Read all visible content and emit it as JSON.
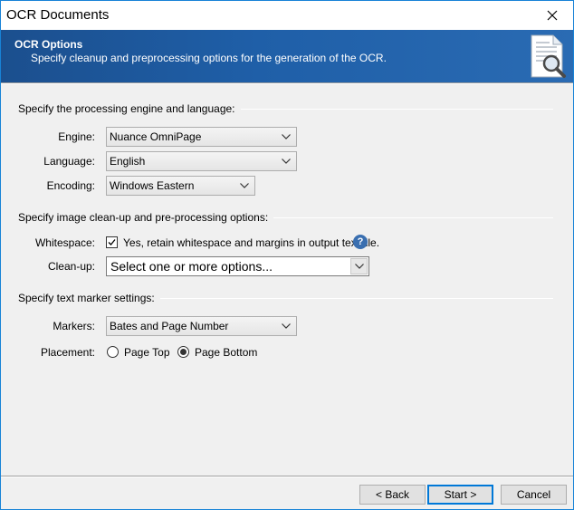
{
  "window": {
    "title": "OCR Documents"
  },
  "banner": {
    "title": "OCR Options",
    "subtitle": "Specify cleanup and preprocessing options for the generation of the OCR.",
    "icon": "document-search-icon"
  },
  "engine_group": {
    "header": "Specify the processing engine and language:",
    "engine_label": "Engine:",
    "engine_value": "Nuance OmniPage",
    "language_label": "Language:",
    "language_value": "English",
    "encoding_label": "Encoding:",
    "encoding_value": "Windows Eastern"
  },
  "cleanup_group": {
    "header": "Specify image clean-up and pre-processing options:",
    "whitespace_label": "Whitespace:",
    "whitespace_checked": true,
    "whitespace_text": "Yes, retain whitespace and margins in output text file.",
    "cleanup_label": "Clean-up:",
    "cleanup_placeholder": "Select one or more options..."
  },
  "marker_group": {
    "header": "Specify text marker settings:",
    "markers_label": "Markers:",
    "markers_value": "Bates and Page Number",
    "placement_label": "Placement:",
    "placement_options": [
      "Page Top",
      "Page Bottom"
    ],
    "placement_selected": "Page Bottom"
  },
  "footer": {
    "back_label": "< Back",
    "start_label": "Start >",
    "cancel_label": "Cancel"
  },
  "colors": {
    "banner": "#1f5fa8",
    "accent": "#0078d7",
    "help": "#3a6fb0"
  }
}
